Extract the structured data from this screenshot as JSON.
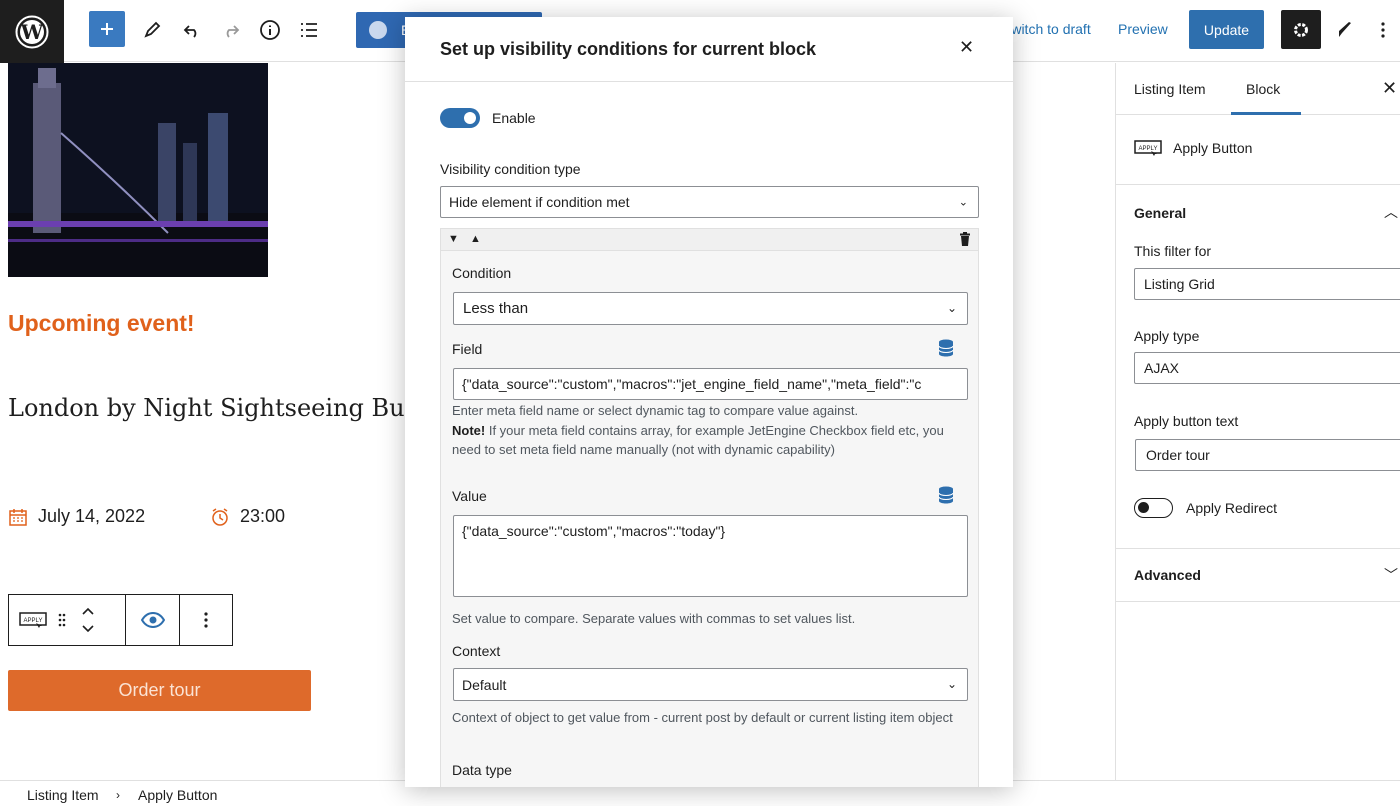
{
  "topbar": {
    "switch_draft": "Switch to draft",
    "preview": "Preview",
    "update": "Update",
    "elementor_label": "E"
  },
  "canvas": {
    "upcoming": "Upcoming event!",
    "title": "London by Night Sightseeing Bus Tour",
    "date": "July 14, 2022",
    "time": "23:00",
    "order_button": "Order tour"
  },
  "modal": {
    "title": "Set up visibility conditions for current block",
    "enable_label": "Enable",
    "enable_on": true,
    "visibility_type_label": "Visibility condition type",
    "visibility_type_value": "Hide element if condition met",
    "condition_label": "Condition",
    "condition_value": "Less than",
    "field_label": "Field",
    "field_value": "{\"data_source\":\"custom\",\"macros\":\"jet_engine_field_name\",\"meta_field\":\"c",
    "field_help": "Enter meta field name or select dynamic tag to compare value against.",
    "field_note_bold": "Note!",
    "field_note": " If your meta field contains array, for example JetEngine Checkbox field etc, you need to set meta field name manually (not with dynamic capability)",
    "value_label": "Value",
    "value_value": "{\"data_source\":\"custom\",\"macros\":\"today\"}",
    "value_help": "Set value to compare. Separate values with commas to set values list.",
    "context_label": "Context",
    "context_value": "Default",
    "context_help": "Context of object to get value from - current post by default or current listing item object",
    "data_type_label": "Data type"
  },
  "sidebar": {
    "tab_listing": "Listing Item",
    "tab_block": "Block",
    "block_name": "Apply Button",
    "general": "General",
    "filter_for_label": "This filter for",
    "filter_for_value": "Listing Grid",
    "apply_type_label": "Apply type",
    "apply_type_value": "AJAX",
    "apply_text_label": "Apply button text",
    "apply_text_value": "Order tour",
    "apply_redirect_label": "Apply Redirect",
    "apply_redirect_on": false,
    "advanced": "Advanced"
  },
  "breadcrumb": {
    "item1": "Listing Item",
    "item2": "Apply Button"
  },
  "colors": {
    "accent": "#2e6fae",
    "orange": "#e0611b",
    "order_button": "#de6a2b",
    "dark": "#1e1e1e"
  }
}
